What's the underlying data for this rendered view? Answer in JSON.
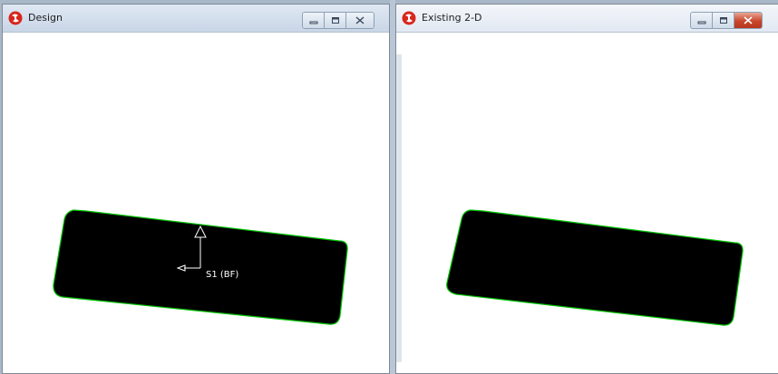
{
  "windows": [
    {
      "title": "Design",
      "controls": [
        "minimize-icon",
        "restore-icon",
        "close-icon"
      ],
      "section_label": "S1 (BF)"
    },
    {
      "title": "Existing 2-D",
      "controls": [
        "minimize-icon",
        "restore-icon",
        "close-icon"
      ]
    }
  ],
  "colors": {
    "shape_fill": "#000000",
    "shape_outline": "#00c400",
    "close_active": "#c8462c",
    "app_icon": "#d8261c"
  }
}
